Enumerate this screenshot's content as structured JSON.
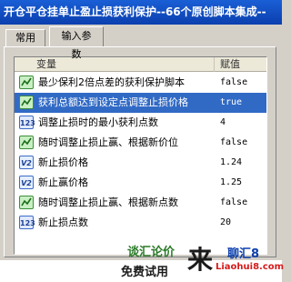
{
  "window": {
    "title": "开仓平仓挂单止盈止损获利保护--66个原创脚本集成--"
  },
  "tabs": [
    {
      "label": "常用"
    },
    {
      "label": "输入参数"
    }
  ],
  "grid": {
    "col_variable": "变量",
    "col_value": "赋值",
    "rows": [
      {
        "type": "bool",
        "icon": "bool-icon",
        "name": "最少保利2倍点差的获利保护脚本",
        "value": "false"
      },
      {
        "type": "bool",
        "icon": "bool-icon",
        "name": "获利总额达到设定点调整止损价格",
        "value": "true"
      },
      {
        "type": "int",
        "icon": "int-icon",
        "name": "调整止损时的最小获利点数",
        "value": "4"
      },
      {
        "type": "bool",
        "icon": "bool-icon",
        "name": "随时调整止损止赢、根据新价位",
        "value": "false"
      },
      {
        "type": "double",
        "icon": "double-icon",
        "name": "新止损价格",
        "value": "1.24"
      },
      {
        "type": "double",
        "icon": "double-icon",
        "name": "新止赢价格",
        "value": "1.25"
      },
      {
        "type": "bool",
        "icon": "bool-icon",
        "name": "随时调整止损止赢、根据新点数",
        "value": "false"
      },
      {
        "type": "int",
        "icon": "int-icon",
        "name": "新止损点数",
        "value": "20"
      }
    ],
    "selected_row": 1
  },
  "icon_labels": {
    "int": "123",
    "double": "V2"
  },
  "watermark": {
    "line1": "谈汇论价",
    "line2": "免费试用",
    "big": "来",
    "brand": "聊汇8",
    "url": "Liaohui8.com"
  }
}
